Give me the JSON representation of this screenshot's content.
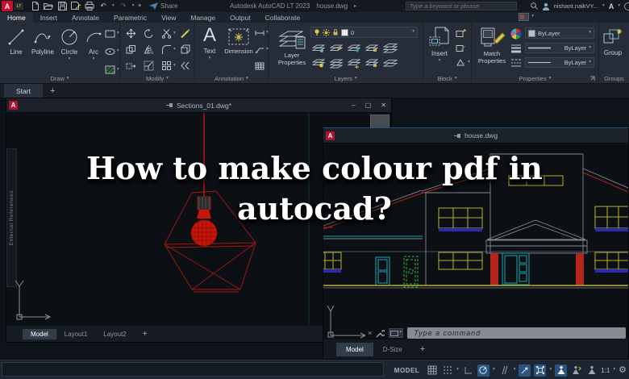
{
  "overlay": {
    "line1": "How to make colour pdf in",
    "line2": "autocad?"
  },
  "titlebar": {
    "logo": "A",
    "logo_badge": "LT",
    "share_label": "Share",
    "app_title": "Autodesk AutoCAD LT 2023",
    "doc_title": "house.dwg",
    "search_placeholder": "Type a keyword or phrase",
    "user_name": "nishant.naikVY..."
  },
  "glyphs": {
    "caret": "▾",
    "minimize": "–",
    "restore": "▢",
    "close": "✕",
    "plus": "+",
    "undo": "↶",
    "redo": "↷",
    "gear": "⚙",
    "doc_arrow": "▸",
    "cmd_close": "×"
  },
  "ribbon_tabs": [
    "Home",
    "Insert",
    "Annotate",
    "Parametric",
    "View",
    "Manage",
    "Output",
    "Collaborate"
  ],
  "panels": {
    "draw": {
      "label": "Draw",
      "tools": [
        "Line",
        "Polyline",
        "Circle",
        "Arc"
      ]
    },
    "modify": {
      "label": "Modify"
    },
    "annotation": {
      "label": "Annotation",
      "text_glyph": "A",
      "text_tool": "Text",
      "dimension_tool": "Dimension"
    },
    "layers": {
      "label": "Layers",
      "big_button": "Layer Properties",
      "current_layer": "0"
    },
    "block": {
      "label": "Block",
      "big_button": "Insert"
    },
    "properties": {
      "label": "Properties",
      "big_button": "Match Properties",
      "color_value": "ByLayer",
      "lineweight_value": "ByLayer",
      "linetype_value": "ByLayer"
    },
    "groups": {
      "label": "Groups",
      "big_button": "Group"
    }
  },
  "file_tabs": {
    "start": "Start"
  },
  "sections_window": {
    "title": "Sections_01.dwg*",
    "palette_tab": "External References",
    "tabs": [
      "Model",
      "Layout1",
      "Layout2"
    ]
  },
  "house_window": {
    "title": "house.dwg",
    "command_placeholder": "Type a command",
    "tabs": [
      "Model",
      "D-Size"
    ]
  },
  "statusbar": {
    "model": "MODEL",
    "scale": "1:1"
  },
  "colors": {
    "logo_red": "#c8102e",
    "drawing_red": "#c01a10",
    "drawing_yellow": "#b5b229",
    "drawing_teal": "#1ba7b5",
    "drawing_green": "#2db52d",
    "sill_blue": "#2a2ac8",
    "status_active_blue": "#2a5580"
  }
}
